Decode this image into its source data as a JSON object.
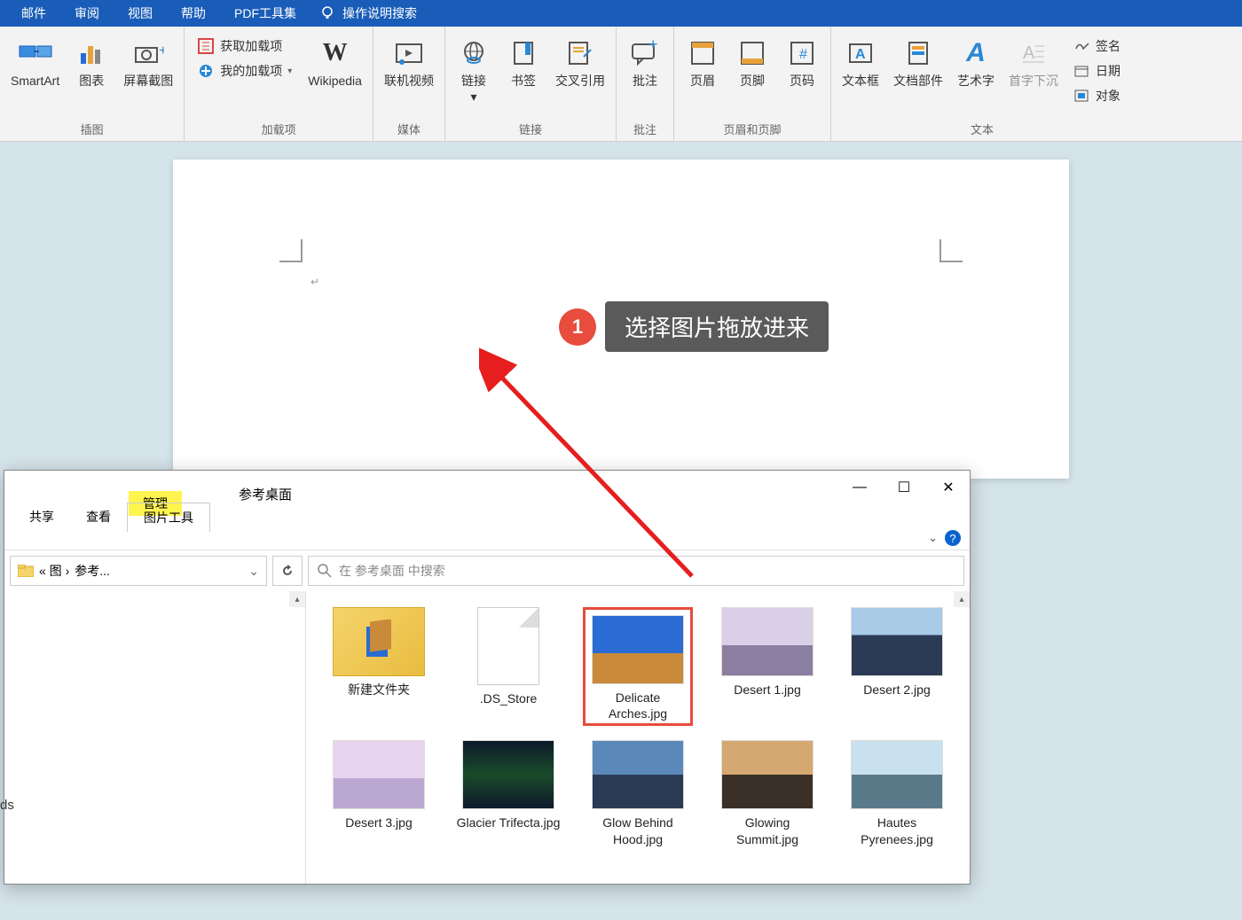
{
  "menu": {
    "items": [
      "邮件",
      "审阅",
      "视图",
      "帮助",
      "PDF工具集"
    ],
    "tellme": "操作说明搜索"
  },
  "ribbon": {
    "group_illustrations": {
      "label": "插图",
      "smartart": "SmartArt",
      "chart": "图表",
      "screenshot": "屏幕截图"
    },
    "group_addins": {
      "label": "加载项",
      "get": "获取加载项",
      "my": "我的加载项",
      "wikipedia": "Wikipedia"
    },
    "group_media": {
      "label": "媒体",
      "online_video": "联机视频"
    },
    "group_links": {
      "label": "链接",
      "link": "链接",
      "bookmark": "书签",
      "crossref": "交叉引用"
    },
    "group_comments": {
      "label": "批注",
      "comment": "批注"
    },
    "group_headerfooter": {
      "label": "页眉和页脚",
      "header": "页眉",
      "footer": "页脚",
      "pagenum": "页码"
    },
    "group_text": {
      "label": "文本",
      "textbox": "文本框",
      "quickparts": "文档部件",
      "wordart": "艺术字",
      "dropcap": "首字下沉",
      "signature": "签名",
      "datetime": "日期",
      "object": "对象"
    }
  },
  "callout": {
    "number": "1",
    "text": "选择图片拖放进来"
  },
  "explorer": {
    "tab_share": "共享",
    "tab_view": "查看",
    "tab_manage": "管理",
    "tab_pictools": "图片工具",
    "title": "参考桌面",
    "breadcrumb_prefix": "«  图  ›",
    "breadcrumb_current": "参考...",
    "search_placeholder": "在 参考桌面 中搜索",
    "files": [
      {
        "name": "新建文件夹",
        "type": "folder"
      },
      {
        "name": ".DS_Store",
        "type": "blank"
      },
      {
        "name": "Delicate Arches.jpg",
        "type": "image",
        "selected": true,
        "gradient": "linear-gradient(#2a6bd4 55%, #c98a3a 55%)"
      },
      {
        "name": "Desert 1.jpg",
        "type": "image",
        "gradient": "linear-gradient(#d9cfe6 55%, #8a7fa0 55%)"
      },
      {
        "name": "Desert 2.jpg",
        "type": "image",
        "gradient": "linear-gradient(#a9cbe8 40%, #2b3a55 40%)"
      },
      {
        "name": "Desert 3.jpg",
        "type": "image",
        "gradient": "linear-gradient(#e6d4ee 55%, #bba8d0 55%)"
      },
      {
        "name": "Glacier Trifecta.jpg",
        "type": "image",
        "gradient": "linear-gradient(#0e1a2a, #1a4a2a, #0e1a2a)"
      },
      {
        "name": "Glow Behind Hood.jpg",
        "type": "image",
        "gradient": "linear-gradient(#5a88b8 50%, #2a3a55 50%)"
      },
      {
        "name": "Glowing Summit.jpg",
        "type": "image",
        "gradient": "linear-gradient(#d4a870 50%, #3a3028 50%)"
      },
      {
        "name": "Hautes Pyrenees.jpg",
        "type": "image",
        "gradient": "linear-gradient(#c9e0ee 50%, #5a7a8a 50%)"
      }
    ]
  },
  "misc": {
    "ads": "ds"
  }
}
